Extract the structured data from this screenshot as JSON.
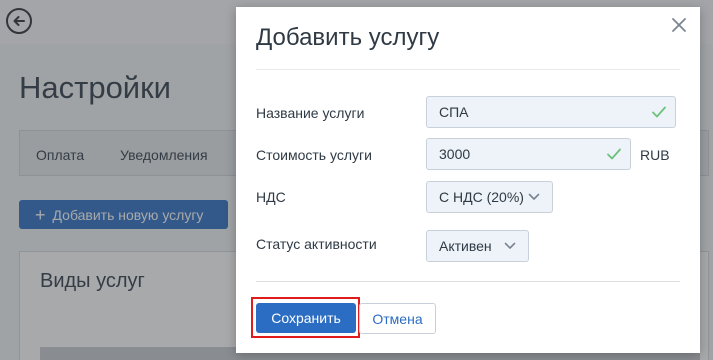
{
  "page": {
    "title": "Настройки",
    "tabs": [
      {
        "label": "Оплата"
      },
      {
        "label": "Уведомления"
      }
    ],
    "add_service_label": "Добавить новую услугу",
    "card_title": "Виды услуг"
  },
  "modal": {
    "title": "Добавить услугу",
    "fields": {
      "name": {
        "label": "Название услуги",
        "value": "СПА"
      },
      "price": {
        "label": "Стоимость услуги",
        "value": "3000",
        "unit": "RUB"
      },
      "vat": {
        "label": "НДС",
        "value": "С НДС (20%)"
      },
      "status": {
        "label": "Статус активности",
        "value": "Активен"
      }
    },
    "save_label": "Сохранить",
    "cancel_label": "Отмена"
  },
  "colors": {
    "accent": "#2b6dc2",
    "valid_check": "#6cc27a",
    "highlight": "#e01b1b",
    "text": "#2f3a45"
  },
  "icons": [
    "back-arrow-icon",
    "plus-icon",
    "close-icon",
    "checkmark-icon",
    "chevron-down-icon"
  ]
}
